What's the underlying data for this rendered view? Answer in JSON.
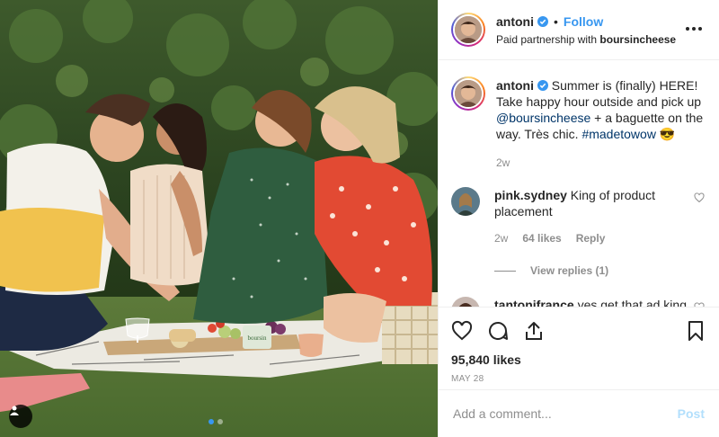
{
  "post": {
    "username": "antoni",
    "follow_label": "Follow",
    "separator": "•",
    "partner_prefix": "Paid partnership with ",
    "partner_name": "boursincheese"
  },
  "caption": {
    "username": "antoni",
    "text_before": " Summer is (finally) HERE! Take happy hour outside and pick up ",
    "mention": "@boursincheese",
    "text_middle": " + a baguette on the way. Très chic. ",
    "hashtag": "#madetowow",
    "emoji": "😎",
    "time": "2w"
  },
  "comments": [
    {
      "username": "pink.sydney",
      "text": " King of product placement",
      "time": "2w",
      "likes": "64 likes",
      "reply": "Reply",
      "view_replies": "View replies (1)"
    },
    {
      "username": "tantonifrance",
      "text": " yes get that ad king"
    }
  ],
  "actions": {
    "likes": "95,840 likes",
    "date": "MAY 28"
  },
  "add_comment": {
    "placeholder": "Add a comment...",
    "post_label": "Post"
  },
  "photo": {
    "cheese_label": "boursin"
  },
  "colors": {
    "accent": "#3897f0",
    "verified": "#3897f0",
    "muted": "#8e8e8e",
    "post_disabled": "#b2dffc"
  }
}
